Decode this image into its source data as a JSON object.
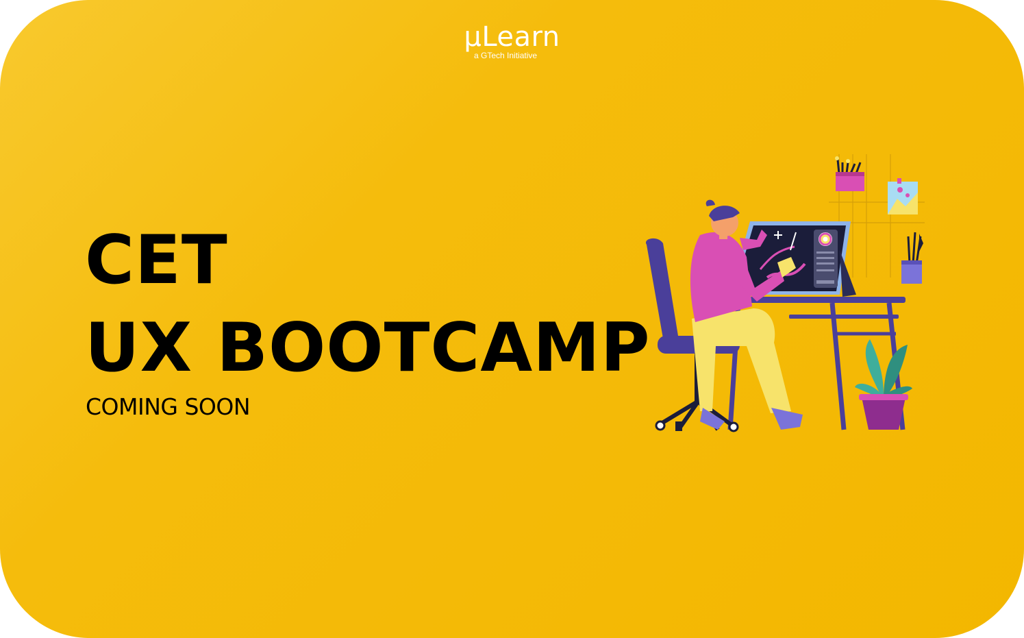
{
  "brand": {
    "logo_text": "µLearn",
    "tagline": "a GTech Initiative"
  },
  "headline": {
    "line1": "CET",
    "line2": "UX BOOTCAMP"
  },
  "subtitle": "COMING SOON",
  "colors": {
    "background": "#f5bc0c",
    "text": "#000000",
    "logo": "#ffffff"
  },
  "illustration": {
    "icon": "designer-at-drawing-tablet-illustration"
  }
}
